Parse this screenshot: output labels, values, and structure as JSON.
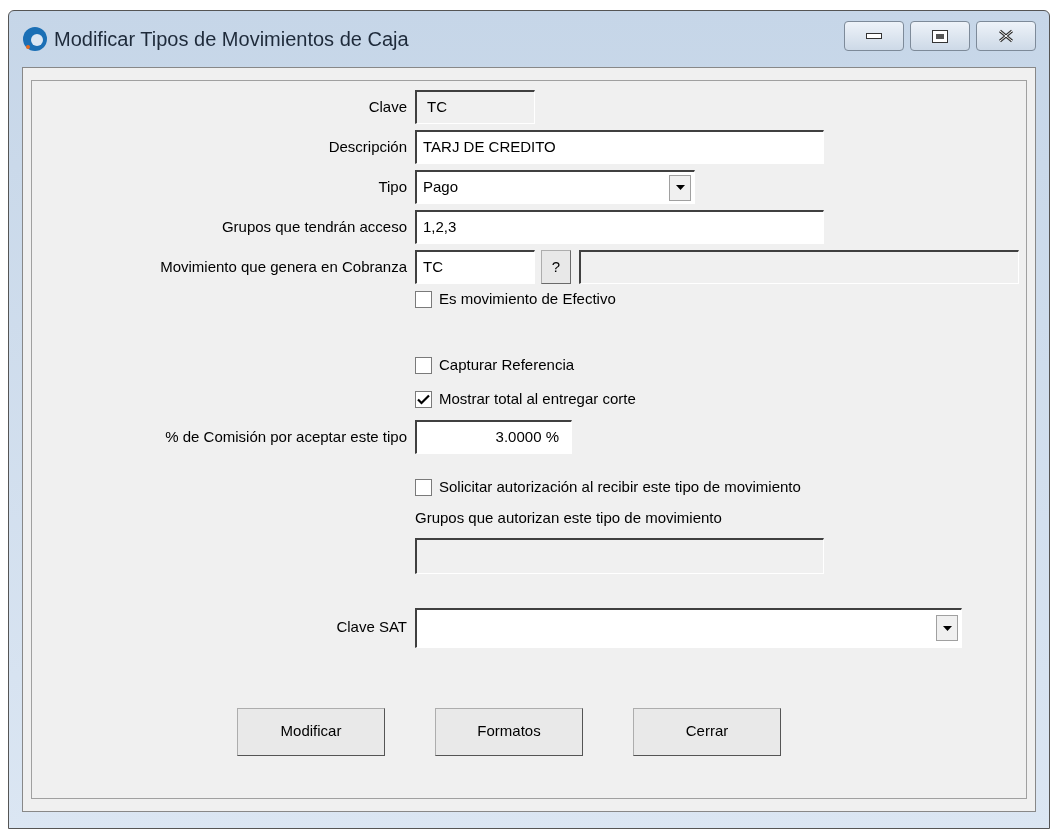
{
  "window": {
    "title": "Modificar Tipos de Movimientos de Caja"
  },
  "fields": [
    {
      "kind": "text",
      "label": "Clave",
      "value": "TC",
      "disabled": true
    },
    {
      "kind": "text",
      "label": "Descripción",
      "value": "TARJ DE CREDITO",
      "disabled": false
    },
    {
      "kind": "combo",
      "label": "Tipo",
      "value": "Pago",
      "disabled": false
    },
    {
      "kind": "text",
      "label": "Grupos que tendrán acceso",
      "value": "1,2,3",
      "disabled": false
    },
    {
      "kind": "lookup",
      "label": "Movimiento que genera en Cobranza",
      "value": "TC",
      "button": "?",
      "disabled": false
    }
  ],
  "cash_checkbox": {
    "label": "Es movimiento de Efectivo",
    "checked": false
  },
  "checkboxes": [
    {
      "label": "Capturar Referencia",
      "checked": false
    },
    {
      "label": "Mostrar total al entregar corte",
      "checked": true
    }
  ],
  "commission": {
    "label": "% de Comisión por aceptar este tipo",
    "value": "3.0000 %"
  },
  "authorization": {
    "checkbox": {
      "label": "Solicitar autorización al recibir este tipo de movimiento",
      "checked": false
    },
    "groups_label": "Grupos que autorizan este tipo de movimiento",
    "groups_disabled": true
  },
  "sat": {
    "label": "Clave SAT"
  },
  "buttons": [
    "Modificar",
    "Formatos",
    "Cerrar"
  ]
}
